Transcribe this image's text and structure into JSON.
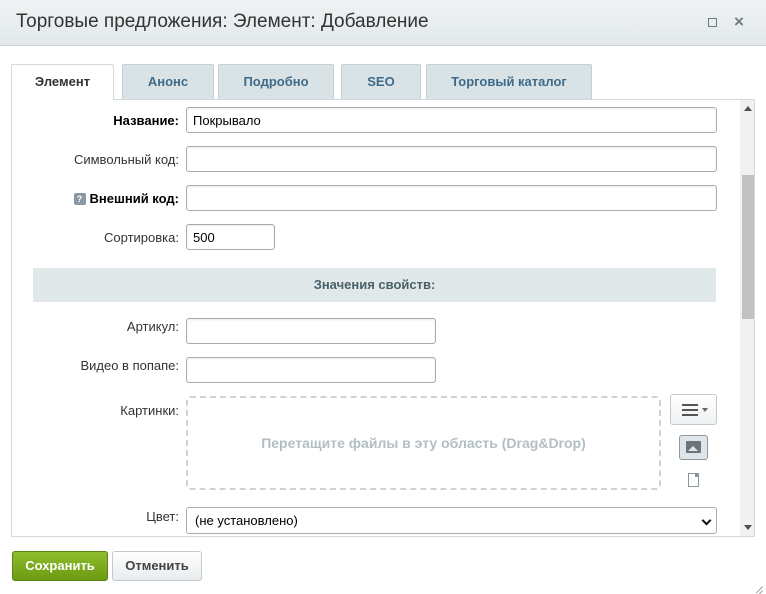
{
  "window": {
    "title": "Торговые предложения: Элемент: Добавление",
    "maximize_icon": "maximize-icon",
    "close_icon": "close-icon",
    "close_glyph": "×"
  },
  "tabs": [
    {
      "label": "Элемент",
      "active": true
    },
    {
      "label": "Анонс",
      "active": false
    },
    {
      "label": "Подробно",
      "active": false
    },
    {
      "label": "SEO",
      "active": false
    },
    {
      "label": "Торговый каталог",
      "active": false
    }
  ],
  "form": {
    "name": {
      "label": "Название:",
      "value": "Покрывало"
    },
    "code": {
      "label": "Символьный код:",
      "value": ""
    },
    "external_code": {
      "label": "Внешний код:",
      "value": "",
      "help_glyph": "?"
    },
    "sort": {
      "label": "Сортировка:",
      "value": "500"
    }
  },
  "properties": {
    "heading": "Значения свойств:",
    "article": {
      "label": "Артикул:",
      "value": ""
    },
    "video": {
      "label": "Видео в попапе:",
      "value": ""
    },
    "pictures": {
      "label": "Картинки:",
      "dropzone_text": "Перетащите файлы в эту область (Drag&Drop)"
    },
    "color": {
      "label": "Цвет:",
      "selected": "(не установлено)"
    }
  },
  "buttons": {
    "save": "Сохранить",
    "cancel": "Отменить"
  },
  "colors": {
    "save_button": "#7aa81c",
    "tab_active_text": "#333333",
    "tab_inactive_text": "#3f6b8b",
    "section_bg": "#e0e8ea"
  }
}
